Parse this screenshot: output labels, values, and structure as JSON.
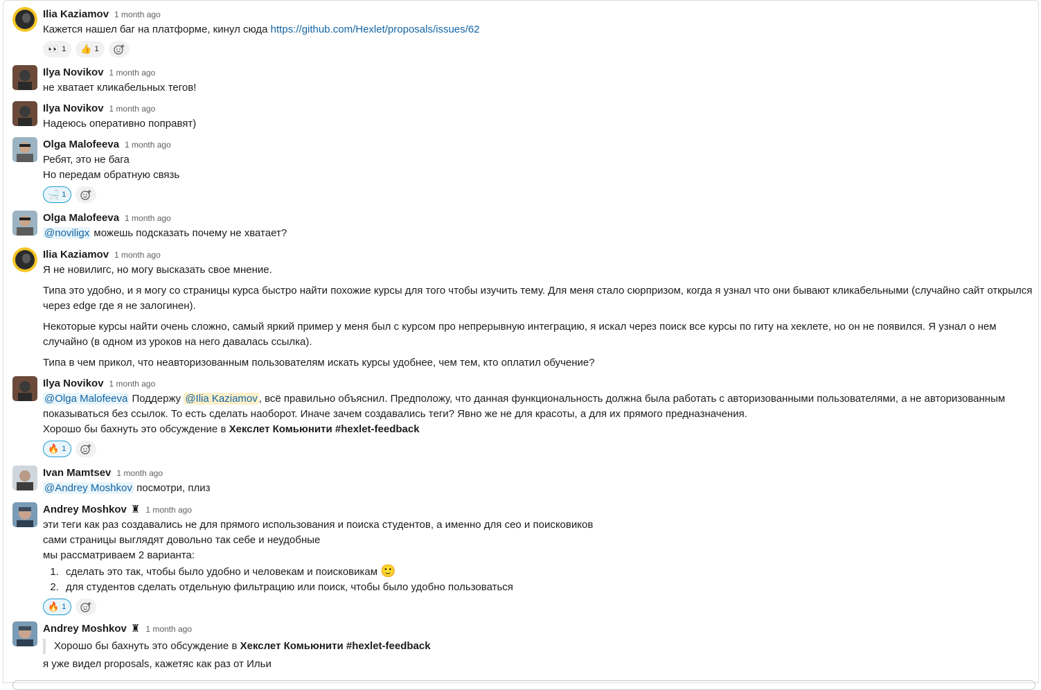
{
  "messages": [
    {
      "author": "Ilia Kaziamov",
      "time": "1 month ago",
      "text_prefix": "Кажется нашел баг на платформе, кинул сюда ",
      "link": "https://github.com/Hexlet/proposals/issues/62",
      "reactions": [
        {
          "emoji": "👀",
          "count": "1"
        },
        {
          "emoji": "👍",
          "count": "1"
        }
      ]
    },
    {
      "author": "Ilya Novikov",
      "time": "1 month ago",
      "text": "не хватает кликабельных тегов!"
    },
    {
      "author": "Ilya Novikov",
      "time": "1 month ago",
      "text": "Надеюсь оперативно поправят)"
    },
    {
      "author": "Olga Malofeeva",
      "time": "1 month ago",
      "lines": [
        "Ребят, это не бага",
        "Но передам обратную связь"
      ],
      "reactions": [
        {
          "emoji": "🛁",
          "count": "1"
        }
      ]
    },
    {
      "author": "Olga Malofeeva",
      "time": "1 month ago",
      "mention": "@noviligx",
      "text": " можешь подсказать почему не хватает?"
    },
    {
      "author": "Ilia Kaziamov",
      "time": "1 month ago",
      "p1": "Я не новилигс, но могу высказать свое мнение.",
      "p2a": "Типа это удобно, и я могу со страницы курса быстро найти похожие курсы для того чтобы изучить тему. Для меня стало сюрпризом, когда я узнал что они бывают кликабельными (случайно сайт открылся",
      "p2b": "через edge где я не залогинен).",
      "p3a": "Некоторые курсы найти очень сложно, самый яркий пример у меня был с курсом про непрерывную интеграцию, я искал через поиск все курсы по гиту на хеклете, но он не появился. Я узнал о нем",
      "p3b": "случайно (в одном из уроков на него давалась ссылка).",
      "p4": "Типа в чем прикол, что неавторизованным пользователям искать курсы удобнее, чем тем, кто оплатил обучение?"
    },
    {
      "author": "Ilya Novikov",
      "time": "1 month ago",
      "mention1": "@Olga Malofeeva",
      "t1": " Поддержу ",
      "mention2": "@Ilia Kaziamov",
      "t2": ", всё правильно объяснил. Предположу, что данная функциональность должна была работать с авторизованными пользователями, а не авторизованным",
      "l2": "показываться без ссылок. То есть сделать наоборот. Иначе зачем создавались теги? Явно же не для красоты, а для их прямого предназначения.",
      "l3a": "Хорошо бы бахнуть это обсуждение в ",
      "l3b": "Хекслет Комьюнити #hexlet-feedback",
      "reactions": [
        {
          "emoji": "🔥",
          "count": "1"
        }
      ]
    },
    {
      "author": "Ivan Mamtsev",
      "time": "1 month ago",
      "mention": "@Andrey Moshkov",
      "text": " посмотри, плиз"
    },
    {
      "author": "Andrey Moshkov",
      "badge": "♜",
      "time": "1 month ago",
      "lines": [
        "эти теги как раз создавались не для прямого использования и поиска студентов, а именно для сео и поисковиков",
        "сами страницы выглядят довольно так себе и неудобные",
        "мы рассматриваем 2 варианта:"
      ],
      "list": [
        "сделать это так, чтобы было удобно и человекам и поисковикам",
        "для студентов сделать отдельную фильтрацию или поиск, чтобы было удобно пользоваться"
      ],
      "list_emoji": "🙂",
      "reactions": [
        {
          "emoji": "🔥",
          "count": "1"
        }
      ]
    },
    {
      "author": "Andrey Moshkov",
      "badge": "♜",
      "time": "1 month ago",
      "quote_a": "Хорошо бы бахнуть это обсуждение в ",
      "quote_b": "Хекслет Комьюнити #hexlet-feedback",
      "text": "я уже видел proposals, кажетяс как раз от Ильи"
    }
  ],
  "colors": {
    "link": "#1264a3",
    "mention_bg": "#e8f5fa",
    "mention_self_bg": "#fef0c9",
    "reaction_bg": "#f1f1f1",
    "reaction_active_border": "#1d9bd1"
  },
  "icons": {
    "add_reaction": "add-reaction-icon"
  }
}
